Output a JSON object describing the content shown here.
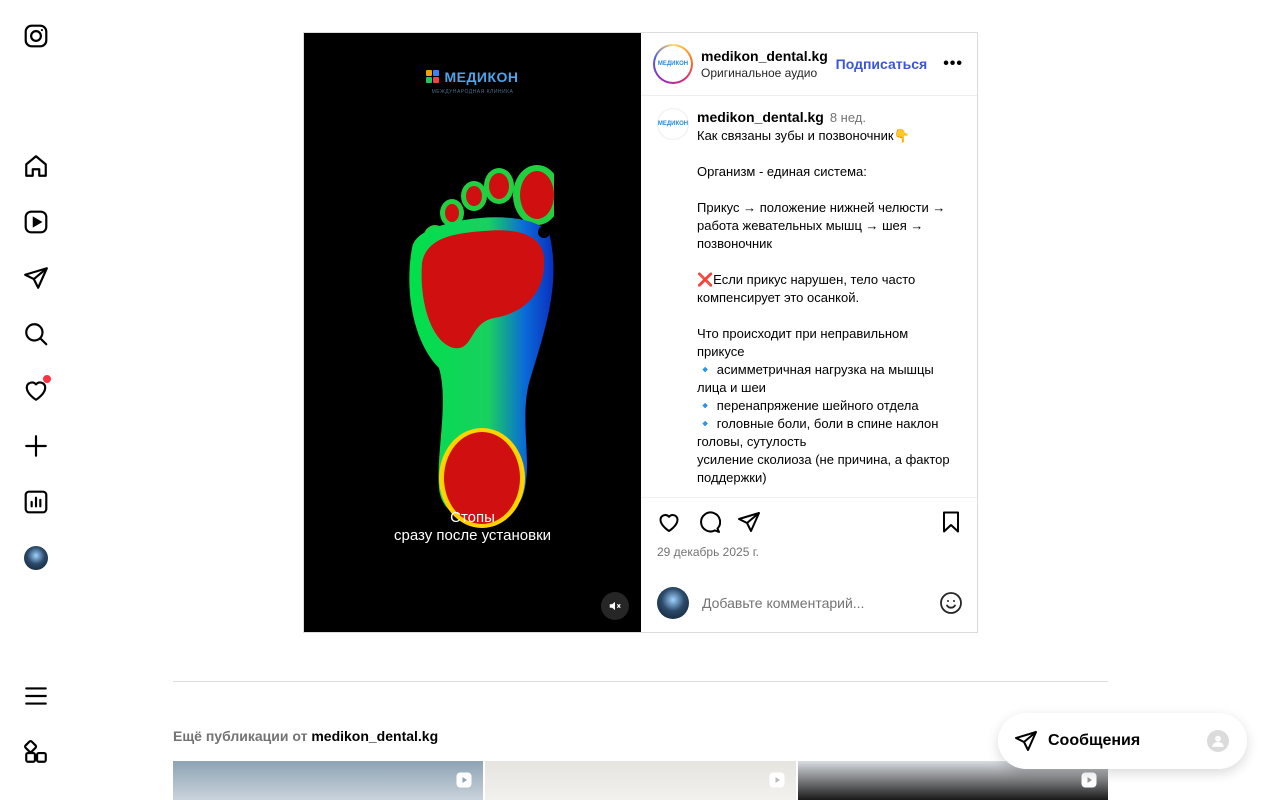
{
  "nav": {
    "items": [
      "instagram-logo",
      "home",
      "reels",
      "messages",
      "search",
      "notifications",
      "create",
      "dashboard",
      "profile",
      "more",
      "also-from-meta"
    ]
  },
  "media": {
    "brand_name": "МЕДИКОН",
    "brand_sub": "МЕЖДУНАРОДНАЯ КЛИНИКА",
    "caption_line1": "Стопы",
    "caption_line2": "сразу после установки"
  },
  "header": {
    "username": "medikon_dental.kg",
    "audio": "Оригинальное аудио",
    "follow_label": "Подписаться",
    "more_label": "•••"
  },
  "comment": {
    "username": "medikon_dental.kg",
    "time": "8 нед.",
    "lines": [
      "Как связаны зубы и позвоночник👇",
      "",
      "Организм - единая система:",
      "",
      "Прикус → положение нижней челюсти → работа жевательных мышц → шея → позвоночник",
      "",
      "❌Если прикус нарушен, тело часто компенсирует это осанкой.",
      "",
      "Что происходит при неправильном прикусе",
      "🔹 асимметричная нагрузка на мышцы лица и шеи",
      "🔹 перенапряжение шейного отдела",
      "🔹 головные боли, боли в спине наклон головы, сутулость",
      "усиление сколиоза (не причина, а фактор",
      "поддержки)"
    ]
  },
  "footer": {
    "date": "29 декабрь 2025 г.",
    "comment_placeholder": "Добавьте комментарий..."
  },
  "more": {
    "prefix": "Ещё публикации от",
    "username": "medikon_dental.kg"
  },
  "messages_pill": {
    "label": "Сообщения"
  },
  "colors": {
    "follow": "#3a56d4",
    "notif": "#ff3040",
    "border": "#dbdbdb"
  }
}
